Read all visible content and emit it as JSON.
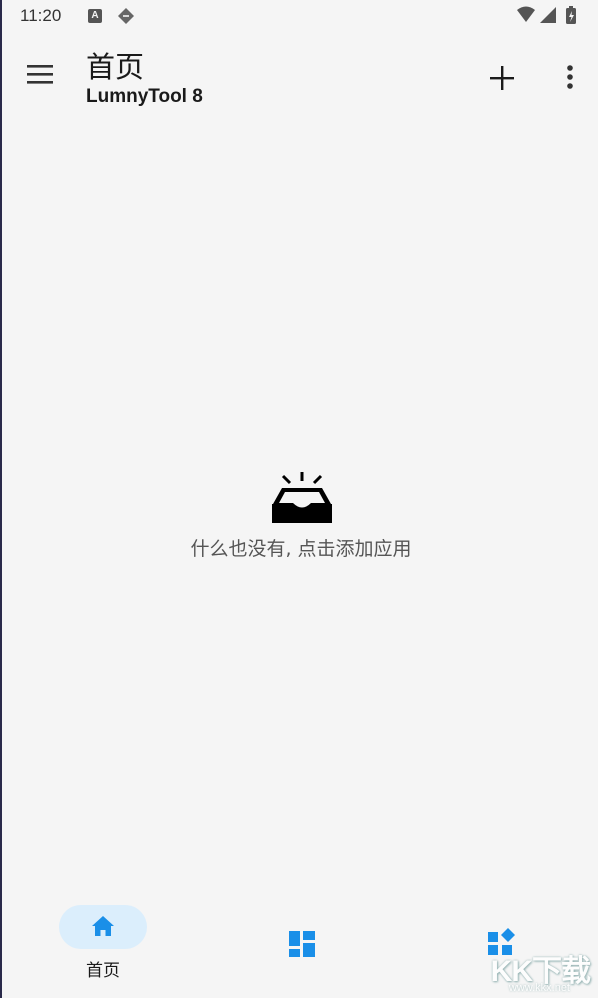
{
  "status_bar": {
    "time": "11:20",
    "notification_icon_letter": "A"
  },
  "app_bar": {
    "title": "首页",
    "subtitle": "LumnyTool 8",
    "menu_icon": "menu-icon",
    "add_icon": "plus-icon",
    "more_icon": "more-vert-icon"
  },
  "empty_state": {
    "icon": "empty-inbox-icon",
    "message": "什么也没有, 点击添加应用"
  },
  "bottom_nav": {
    "items": [
      {
        "label": "首页",
        "icon": "home-icon",
        "active": true
      },
      {
        "label": "",
        "icon": "dashboard-icon",
        "active": false
      },
      {
        "label": "",
        "icon": "apps-icon",
        "active": false
      }
    ]
  },
  "watermark": {
    "text": "KK下载",
    "url": "www.kkx.net"
  },
  "colors": {
    "background": "#f5f5f5",
    "accent": "#1a8fe8",
    "active_pill": "#dbeefc",
    "text_primary": "#1a1a1a",
    "text_secondary": "#555555"
  }
}
